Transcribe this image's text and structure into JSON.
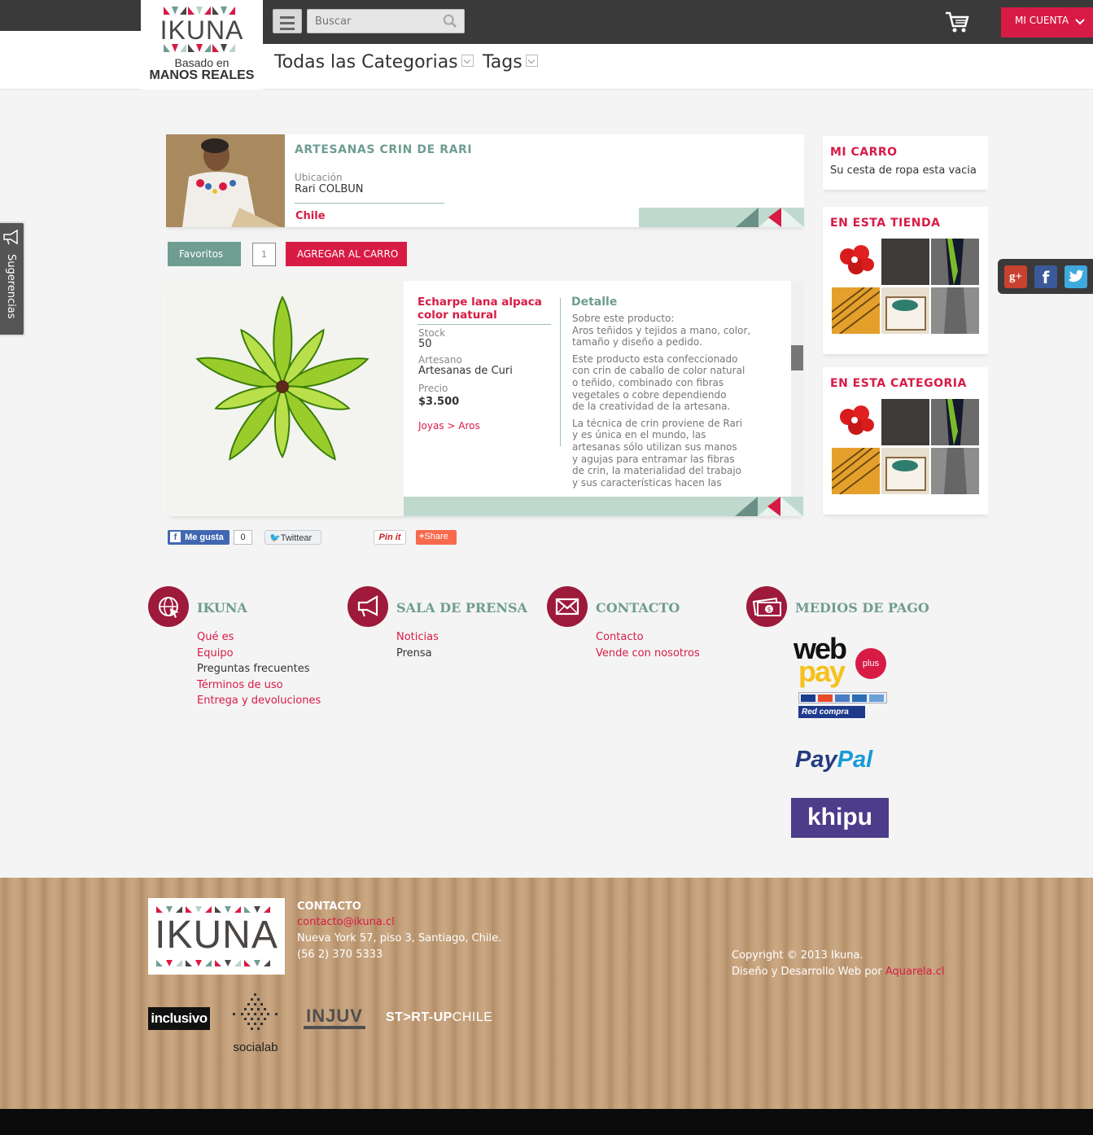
{
  "header": {
    "logo_text": "IKUNA",
    "logo_tagline_1": "Basado en",
    "logo_tagline_2": "MANOS REALES",
    "search_placeholder": "Buscar",
    "account_label": "MI CUENTA",
    "nav": [
      {
        "label": "Todas las Categorias"
      },
      {
        "label": "Tags"
      }
    ]
  },
  "shop": {
    "name": "ARTESANAS CRIN DE RARI",
    "location_label": "Ubicación",
    "location_value": "Rari COLBUN",
    "country": "Chile"
  },
  "actions": {
    "favorites_label": "Favoritos",
    "quantity": "1",
    "add_to_cart_label": "AGREGAR AL CARRO"
  },
  "product": {
    "title": "Echarpe lana alpaca color natural",
    "stock_label": "Stock",
    "stock_value": "50",
    "artisan_label": "Artesano",
    "artisan_value": "Artesanas de Curi",
    "price_label": "Precio",
    "price_value": "$3.500",
    "breadcrumb": "Joyas > Aros",
    "detail_title": "Detalle",
    "detail_lines": [
      "Sobre este producto:",
      "Aros teñidos y tejidos a mano, color,",
      "tamaño y diseño a pedido.",
      "",
      "Este producto esta confeccionado",
      "con crin de caballo de color natural",
      "o teñido, combinado con fibras",
      "vegetales o cobre dependiendo",
      "de la creatividad de la artesana.",
      "",
      "La técnica de crin proviene de Rari",
      "y es única en el mundo, las",
      "artesanas sólo utilizan sus manos",
      "y agujas para entramar las fibras",
      "de crin, la materialidad del trabajo",
      "y sus características hacen las"
    ]
  },
  "social_share": {
    "like_label": "Me gusta",
    "like_count": "0",
    "twitter_label": "Twittear",
    "pinit_label": "Pin it",
    "share_label": "Share"
  },
  "sidebar": {
    "cart_title": "MI CARRO",
    "cart_empty": "Su cesta de ropa esta vacia",
    "store_title": "EN ESTA TIENDA",
    "category_title": "EN ESTA CATEGORIA"
  },
  "suggestions_label": "Sugerencias",
  "footer": {
    "columns": [
      {
        "title": "IKUNA",
        "links": [
          {
            "label": "Qué es",
            "dark": false
          },
          {
            "label": "Equipo",
            "dark": false
          },
          {
            "label": "Preguntas frecuentes",
            "dark": true
          },
          {
            "label": "Términos de uso",
            "dark": false
          },
          {
            "label": "Entrega y devoluciones",
            "dark": false
          }
        ]
      },
      {
        "title": "SALA DE PRENSA",
        "links": [
          {
            "label": "Noticias",
            "dark": false
          },
          {
            "label": "Prensa",
            "dark": true
          }
        ]
      },
      {
        "title": "CONTACTO",
        "links": [
          {
            "label": "Contacto",
            "dark": false
          },
          {
            "label": "Vende con nosotros",
            "dark": false
          }
        ]
      },
      {
        "title": "MEDIOS DE PAGO",
        "links": []
      }
    ],
    "payment": {
      "webpay_1": "web",
      "webpay_2": "pay",
      "webpay_plus": "plus",
      "redcompra": "Red compra",
      "paypal_1": "Pay",
      "paypal_2": "Pal",
      "khipu": "khipu"
    },
    "contact_title": "CONTACTO",
    "contact_email": "contacto@ikuna.cl",
    "contact_address": "Nueva York 57, piso 3, Santiago, Chile.",
    "contact_phone": "(56 2) 370 5333",
    "copyright": "Copyright © 2013 Ikuna.",
    "credit_prefix": "Diseño y Desarrollo Web por ",
    "credit_link": "Aquarela.cl",
    "partners": {
      "inclusivo": "inclusivo",
      "socialab": "socialab",
      "injuv": "INJUV",
      "startup_1": "ST>RT-UP",
      "startup_2": "CHILE"
    },
    "logo_text": "IKUNA"
  },
  "colors": {
    "brand_red": "#d81b45",
    "teal": "#6f9d91",
    "dark_bar": "#3b3a3b",
    "pale_green": "#bfd9cf"
  }
}
